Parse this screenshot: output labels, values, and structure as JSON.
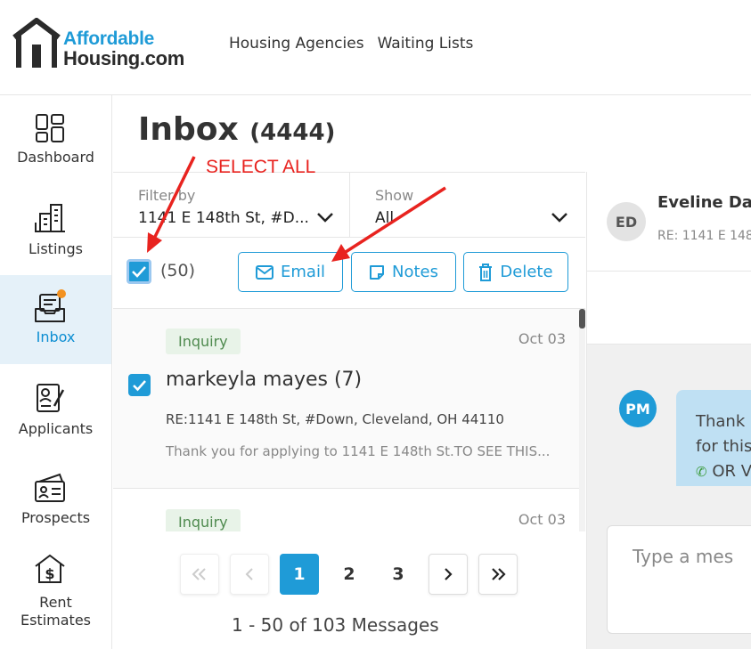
{
  "brand": {
    "line1": "Affordable",
    "line2": "Housing.com"
  },
  "topnav": {
    "housing_agencies": "Housing Agencies",
    "waiting_lists": "Waiting Lists"
  },
  "sidebar": {
    "items": [
      {
        "label": "Dashboard"
      },
      {
        "label": "Listings"
      },
      {
        "label": "Inbox"
      },
      {
        "label": "Applicants"
      },
      {
        "label": "Prospects"
      },
      {
        "label": "Rent\nEstimates"
      }
    ]
  },
  "inbox": {
    "title": "Inbox",
    "count": "(4444)"
  },
  "filters": {
    "filter_by_label": "Filter by",
    "filter_by_value": "1141 E 148th St, #D...",
    "show_label": "Show",
    "show_value": "All"
  },
  "actions": {
    "selected_count": "(50)",
    "email": "Email",
    "notes": "Notes",
    "delete": "Delete"
  },
  "annotation": {
    "select_all": "SELECT ALL"
  },
  "messages": [
    {
      "tag": "Inquiry",
      "date": "Oct 03",
      "name": "markeyla mayes (7)",
      "re": "RE:1141 E 148th St, #Down, Cleveland, OH 44110",
      "snippet": "Thank you for applying to 1141 E 148th St.TO SEE THIS..."
    },
    {
      "tag": "Inquiry",
      "date": "Oct 03"
    }
  ],
  "pagination": {
    "pages": [
      "1",
      "2",
      "3"
    ],
    "status": "1 - 50 of 103 Messages"
  },
  "conversation": {
    "contact_initials": "ED",
    "contact_name": "Eveline Da",
    "contact_re": "RE: 1141 E 148t",
    "sender_initials": "PM",
    "bubble_line1": "Thank",
    "bubble_line2": "for this",
    "bubble_line3": "OR V",
    "input_placeholder": "Type a mes"
  },
  "colors": {
    "accent": "#1f9bd7",
    "annotation": "#e8231f",
    "badge": "#f39221"
  }
}
